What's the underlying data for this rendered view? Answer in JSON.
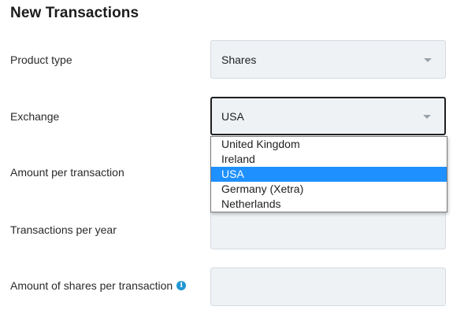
{
  "page": {
    "title": "New Transactions"
  },
  "form": {
    "product_type": {
      "label": "Product type",
      "value": "Shares"
    },
    "exchange": {
      "label": "Exchange",
      "value": "USA",
      "options": [
        "United Kingdom",
        "Ireland",
        "USA",
        "Germany (Xetra)",
        "Netherlands"
      ],
      "highlighted_index": 2
    },
    "amount_per_transaction": {
      "label": "Amount per transaction",
      "value": ""
    },
    "transactions_per_year": {
      "label": "Transactions per year",
      "value": ""
    },
    "amount_of_shares_per_transaction": {
      "label": "Amount of shares per transaction",
      "value": "",
      "info_icon": "info-icon"
    }
  },
  "colors": {
    "field_background": "#eef2f5",
    "highlight": "#1e90ff",
    "info_icon": "#2196d3"
  }
}
